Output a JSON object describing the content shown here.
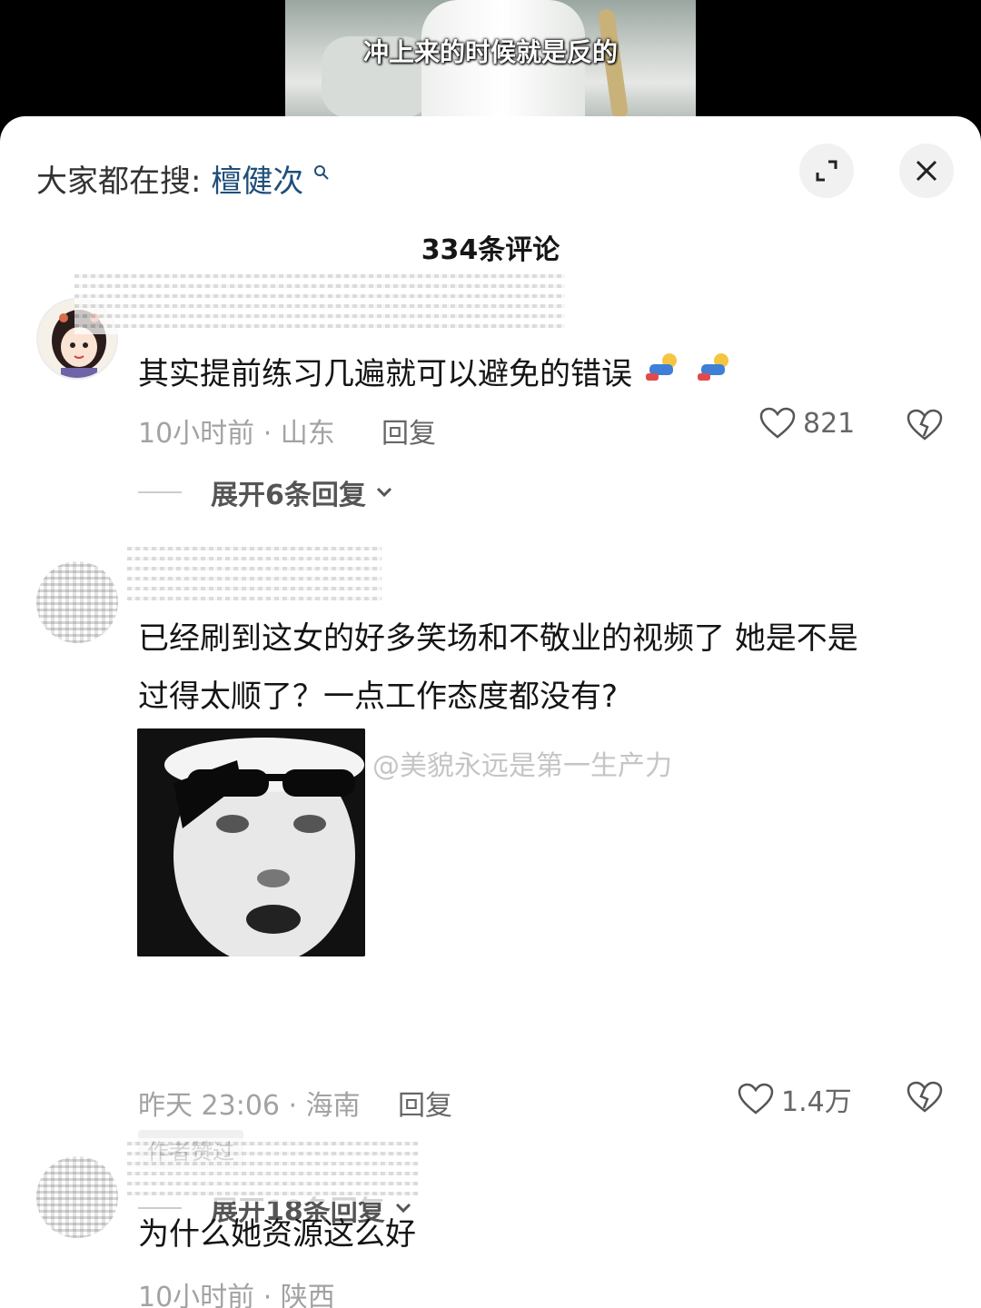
{
  "video": {
    "subtitle": "冲上来的时候就是反的"
  },
  "header": {
    "search_prefix": "大家都在搜:",
    "search_keyword": "檀健次",
    "search_icon": "search-icon",
    "expand_icon": "expand-icon",
    "close_icon": "close-icon",
    "comment_count_title": "334条评论"
  },
  "comments": [
    {
      "text": "其实提前练习几遍就可以避免的错误",
      "time_location": "10小时前 · 山东",
      "reply_label": "回复",
      "likes": "821",
      "expand_label": "展开6条回复"
    },
    {
      "text_line1": "已经刷到这女的好多笑场和不敬业的视频了 她是不是",
      "text_line2": "过得太顺了？一点工作态度都没有?",
      "time_location": "昨天 23:06 · 海南",
      "reply_label": "回复",
      "likes": "1.4万",
      "author_tag": "作者赞过",
      "expand_label": "展开18条回复"
    },
    {
      "text": "为什么她资源这么好",
      "time_location": "10小时前 · 陕西"
    }
  ],
  "watermark": "@美貌永远是第一生产力"
}
